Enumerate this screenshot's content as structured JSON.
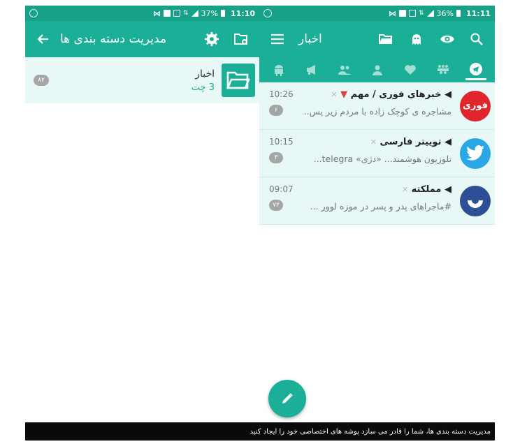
{
  "left": {
    "status": {
      "battery": "37%",
      "time": "11:10"
    },
    "appbar": {
      "title": "مدیریت دسته بندی ها"
    },
    "folder": {
      "name": "اخبار",
      "count": "3 چت",
      "badge": "۸۲"
    }
  },
  "right": {
    "status": {
      "battery": "36%",
      "time": "11:11"
    },
    "appbar": {
      "title": "اخبار"
    },
    "chats": [
      {
        "title": "خبرهای فوری / مهم",
        "time": "10:26",
        "preview": "مشاجره ی کوچک زاده با مردم زیر پس...",
        "unread": "۶",
        "avatar_text": "فوری"
      },
      {
        "title": "توییتر فارسی",
        "time": "10:15",
        "preview": "تلوزیون هوشمند... «دژی» telegra...",
        "unread": "۳"
      },
      {
        "title": "مملکته",
        "time": "09:07",
        "preview": "#ماجراهای پدر و پسر  در موزه لوور ...",
        "unread": "۷۲"
      }
    ]
  },
  "caption": "مدیریت دسته بندی ها، شما را قادر می سازد پوشه های اختصاصی خود را ایجاد کنید",
  "colors": {
    "primary": "#1aaf96",
    "status": "#16a188",
    "row_bg": "#e7f8f7",
    "badge": "#a6a6a6"
  },
  "icons": [
    "back-arrow-icon",
    "settings-gear-icon",
    "new-folder-icon",
    "menu-icon",
    "folder-icon",
    "ghost-icon",
    "eye-icon",
    "search-icon",
    "android-icon",
    "megaphone-icon",
    "group-icon",
    "user-icon",
    "heart-icon",
    "bots-icon",
    "telegram-icon",
    "pencil-icon"
  ]
}
